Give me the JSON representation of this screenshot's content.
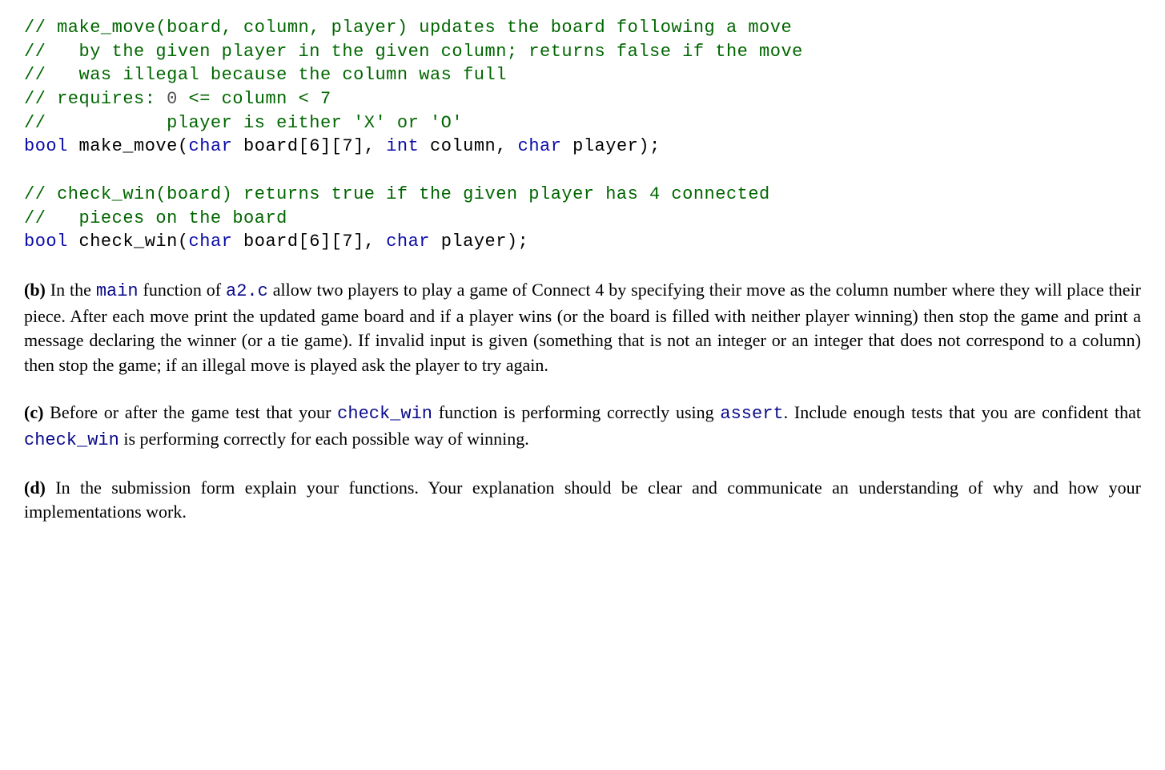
{
  "code": {
    "c1": "// make_move(board, column, player) updates the board following a move",
    "c2": "//   by the given player in the given column; returns false if the move",
    "c3": "//   was illegal because the column was full",
    "c4a": "// requires: ",
    "c4_zero": "0",
    "c4b": " <= column < 7",
    "c5": "//           player is either 'X' or 'O'",
    "kw_bool1": "bool",
    "fn1_a": " make_move(",
    "kw_char1": "char",
    "fn1_b": " board[6][7], ",
    "kw_int1": "int",
    "fn1_c": " column, ",
    "kw_char2": "char",
    "fn1_d": " player);",
    "c6": "// check_win(board) returns true if the given player has 4 connected",
    "c7": "//   pieces on the board",
    "kw_bool2": "bool",
    "fn2_a": " check_win(",
    "kw_char3": "char",
    "fn2_b": " board[6][7], ",
    "kw_char4": "char",
    "fn2_c": " player);"
  },
  "parts": {
    "b": {
      "label": "(b)",
      "t1": "  In the ",
      "code1": "main",
      "t2": " function of ",
      "code2": "a2.c",
      "t3": " allow two players to play a game of Connect 4 by specifying their move as the column number where they will place their piece. After each move print the updated game board and if a player wins (or the board is filled with neither player winning) then stop the game and print a message declaring the winner (or a tie game). If invalid input is given (something that is not an integer or an integer that does not correspond to a column) then stop the game; if an illegal move is played ask the player to try again."
    },
    "c": {
      "label": "(c)",
      "t1": "  Before or after the game test that your ",
      "code1": "check_win",
      "t2": " function is performing correctly using ",
      "code2": "assert",
      "t3": ". Include enough tests that you are confident that ",
      "code3": "check_win",
      "t4": " is performing correctly for each possible way of winning."
    },
    "d": {
      "label": "(d)",
      "t1": "  In the submission form explain your functions.  Your explanation should be clear and communicate an understanding of why and how your implementations work."
    }
  }
}
